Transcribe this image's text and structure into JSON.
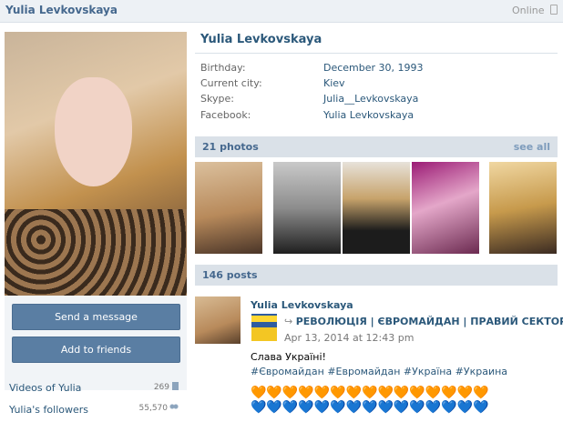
{
  "topbar": {
    "name": "Yulia Levkovskaya",
    "online": "Online"
  },
  "profile": {
    "name": "Yulia Levkovskaya",
    "info": [
      {
        "key": "Birthday:",
        "value": "December 30, 1993"
      },
      {
        "key": "Current city:",
        "value": "Kiev"
      },
      {
        "key": "Skype:",
        "value": "Julia__Levkovskaya"
      },
      {
        "key": "Facebook:",
        "value": "Yulia Levkovskaya"
      }
    ]
  },
  "buttons": {
    "send_message": "Send a message",
    "add_friends": "Add to friends"
  },
  "left_links": [
    {
      "label": "Videos of Yulia",
      "count": "269",
      "icon": "video-icon"
    },
    {
      "label": "Yulia's followers",
      "count": "55,570",
      "icon": "people-icon"
    }
  ],
  "photos": {
    "title": "21 photos",
    "see_all": "see all"
  },
  "posts": {
    "title": "146 posts",
    "first": {
      "author": "Yulia Levkovskaya",
      "repost_source": "РЕВОЛЮЦІЯ | ЄВРОМАЙДАН | ПРАВИЙ СЕКТОР",
      "date": "Apr 13, 2014 at 12:43 pm",
      "text": "Слава Україні!",
      "tags": "#Євромайдан #Евромайдан #Україна #Украина",
      "hearts_row1": "🧡🧡🧡🧡🧡🧡🧡🧡🧡🧡🧡🧡🧡🧡🧡",
      "hearts_row2": "💙💙💙💙💙💙💙💙💙💙💙💙💙💙💙"
    }
  },
  "colors": {
    "link": "#2b587a",
    "button": "#5a7ea3",
    "section_bar": "#dae1e8",
    "header": "#edf1f5"
  }
}
